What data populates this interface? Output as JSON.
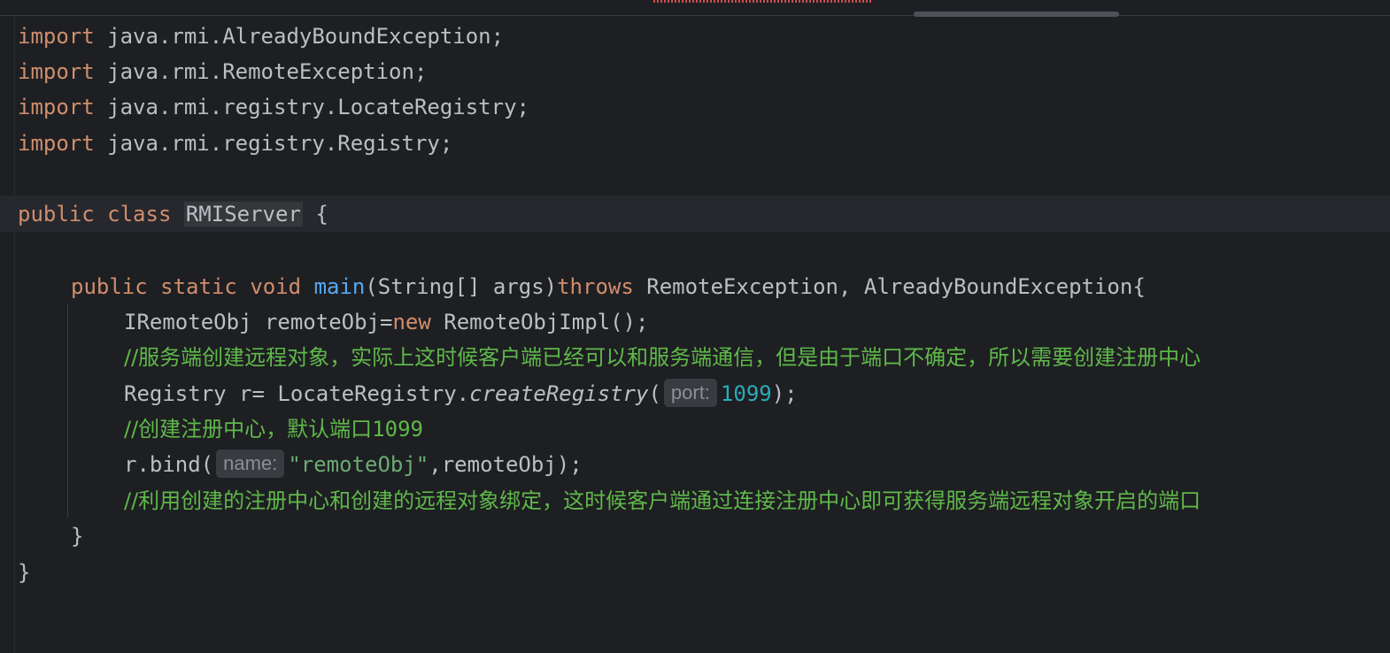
{
  "code": {
    "imports": [
      {
        "keyword": "import",
        "path": "java.rmi.AlreadyBoundException;"
      },
      {
        "keyword": "import",
        "path": "java.rmi.RemoteException;"
      },
      {
        "keyword": "import",
        "path": "java.rmi.registry.LocateRegistry;"
      },
      {
        "keyword": "import",
        "path": "java.rmi.registry.Registry;"
      }
    ],
    "class_decl": {
      "kw_public": "public",
      "kw_class": "class",
      "name": "RMIServer",
      "brace": "{"
    },
    "main_decl": {
      "kw_public": "public",
      "kw_static": "static",
      "kw_void": "void",
      "method": "main",
      "params": "(String[] args)",
      "kw_throws": "throws",
      "exceptions": " RemoteException, AlreadyBoundException{"
    },
    "body": {
      "line1_pre": "IRemoteObj remoteObj=",
      "line1_new": "new",
      "line1_post": " RemoteObjImpl();",
      "comment1": "//服务端创建远程对象，实际上这时候客户端已经可以和服务端通信，但是由于端口不确定，所以需要创建注册中心",
      "line2_pre": "Registry r= LocateRegistry.",
      "line2_method": "createRegistry",
      "line2_open": "(",
      "line2_hint": "port:",
      "line2_value": "1099",
      "line2_close": ");",
      "comment2_text": "//创建注册中心，默认端口",
      "comment2_num": "1099",
      "line3_pre": "r.bind(",
      "line3_hint": "name:",
      "line3_value": "\"remoteObj\"",
      "line3_post": ",remoteObj);",
      "comment3": "//利用创建的注册中心和创建的远程对象绑定，这时候客户端通过连接注册中心即可获得服务端远程对象开启的端口"
    },
    "method_close": "}",
    "class_close": "}"
  },
  "colors": {
    "background": "#1e1f22",
    "keyword": "#cf8e6d",
    "method": "#56a8f5",
    "number": "#2aacb8",
    "string": "#6aab73",
    "comment": "#5fb84a",
    "text": "#bcbec4"
  }
}
